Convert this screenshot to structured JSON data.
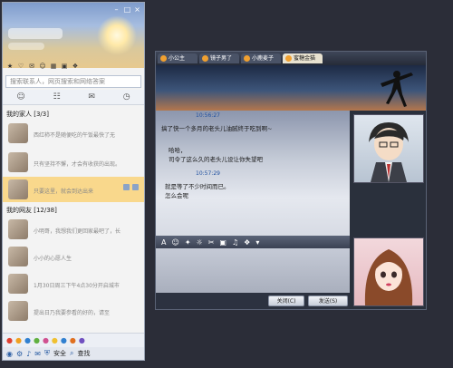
{
  "buddy_list": {
    "search_placeholder": "搜索联系人，网页搜索和网络答案",
    "group_family": "我的家人 [3/3]",
    "group_friends": "我的网友 [12/38]",
    "family": [
      {
        "status": "西红柿不是随便吃的午饭最快了无"
      },
      {
        "status": "只有坚持不懈，才会有收获的出现。"
      },
      {
        "status": "只要这里，就会到达出来"
      }
    ],
    "friends": [
      {
        "status": "小明哥，我想我们更回家最吧了，长"
      },
      {
        "status": "小小的心愿人生"
      },
      {
        "status": "1月30日周三下午4点30分开启城市"
      },
      {
        "status": "提出日乃我要参看的好的，请至"
      }
    ],
    "bottom_bar": {
      "security_label": "安全",
      "search_label": "查找"
    }
  },
  "chat": {
    "tabs": [
      {
        "label": "小公主"
      },
      {
        "label": "镜子男了"
      },
      {
        "label": "小鹿麦子"
      },
      {
        "label": "蜜糖金猫"
      }
    ],
    "messages": [
      {
        "time": "10:56:27",
        "lines": [
          "搞了快一个多月的老头儿油腻终于吃到啊~"
        ]
      },
      {
        "time": "",
        "lines": [
          "哈哈，",
          "司令了这么久的老头儿设让你失望吧"
        ]
      },
      {
        "time": "10:57:29",
        "lines": [
          "就是等了不少时间而已。",
          "怎么会呢"
        ]
      }
    ],
    "close_button": "关闭(C)",
    "send_button": "发送(S)"
  },
  "colors": {
    "selected_contact": "#f9d88c",
    "link_time": "#2050a0"
  }
}
